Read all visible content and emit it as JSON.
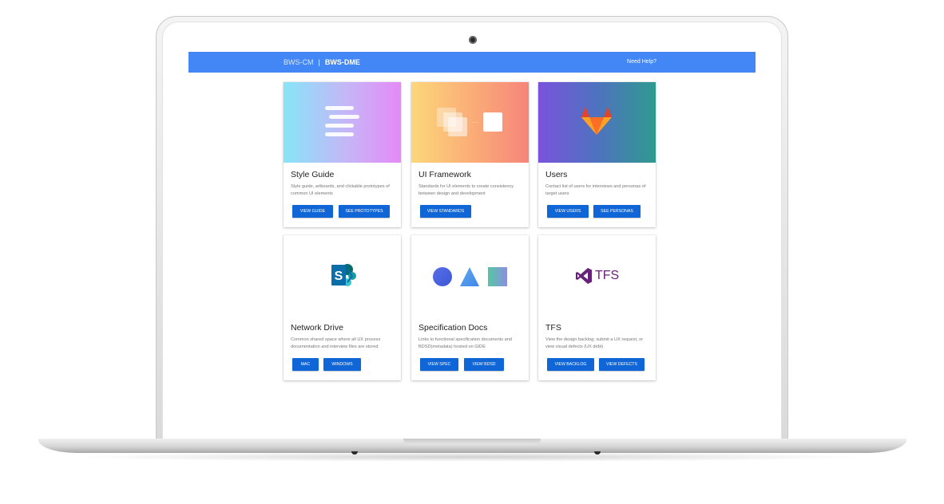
{
  "nav": {
    "inactive_app": "BWS-CM",
    "separator": "|",
    "active_app": "BWS-DME",
    "help": "Need Help?"
  },
  "theme": {
    "navbar": "#4287f5",
    "button": "#1066d6"
  },
  "cards": [
    {
      "title": "Style Guide",
      "description": "Style guide, artboards, and clickable prototypes of common UI elements",
      "icon": "text-lines-icon",
      "buttons": [
        "VIEW GUIDE",
        "SEE PROTOTYPES"
      ]
    },
    {
      "title": "UI Framework",
      "description": "Standards for UI elements to create consistency between design and development",
      "icon": "stacked-squares-icon",
      "buttons": [
        "VIEW STANDARDS"
      ]
    },
    {
      "title": "Users",
      "description": "Contact list of users for interviews and personas of target users",
      "icon": "gitlab-fox-icon",
      "buttons": [
        "VIEW USERS",
        "SEE PERSONAS"
      ]
    },
    {
      "title": "Network Drive",
      "description": "Common shared space where all UX process documentation and interview files are stored",
      "icon": "sharepoint-icon",
      "buttons": [
        "MAC",
        "WINDOWS"
      ]
    },
    {
      "title": "Specification Docs",
      "description": "Links to functional specification documents and BDSD(metadata) hosted on GIDE",
      "icon": "shapes-icon",
      "buttons": [
        "VIEW SPEC",
        "VIEW BDSD"
      ]
    },
    {
      "title": "TFS",
      "description": "View the design backlog; submit a UX request, or view visual defects (UX debt)",
      "icon": "visual-studio-tfs-icon",
      "logo_text": "TFS",
      "buttons": [
        "VIEW BACKLOG",
        "VIEW DEFECTS"
      ]
    }
  ]
}
